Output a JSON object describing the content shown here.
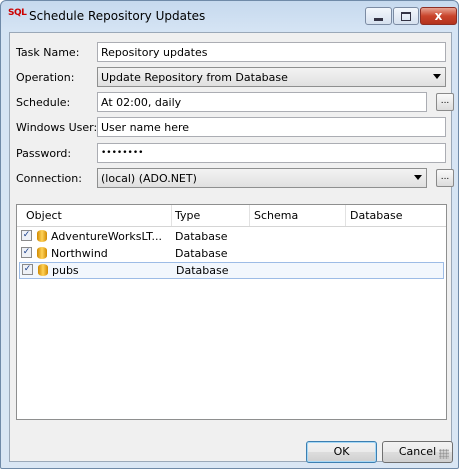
{
  "window": {
    "icon_text": "SQL",
    "title": "Schedule Repository Updates",
    "close_glyph": "x"
  },
  "form": {
    "task_name": {
      "label": "Task Name:",
      "value": "Repository updates"
    },
    "operation": {
      "label": "Operation:",
      "value": "Update Repository from Database"
    },
    "schedule": {
      "label": "Schedule:",
      "value": "At 02:00, daily",
      "button": "..."
    },
    "windows_user": {
      "label": "Windows User:",
      "value": "User name here"
    },
    "password": {
      "label": "Password:",
      "value": "••••••••"
    },
    "connection": {
      "label": "Connection:",
      "value": "(local) (ADO.NET)",
      "button": "..."
    }
  },
  "grid": {
    "columns": [
      "Object",
      "Type",
      "Schema",
      "Database"
    ],
    "rows": [
      {
        "checked": true,
        "object": "AdventureWorksLT...",
        "type": "Database",
        "schema": "",
        "database": ""
      },
      {
        "checked": true,
        "object": "Northwind",
        "type": "Database",
        "schema": "",
        "database": ""
      },
      {
        "checked": true,
        "object": "pubs",
        "type": "Database",
        "schema": "",
        "database": ""
      }
    ],
    "check_glyph": "✓"
  },
  "buttons": {
    "ok": "OK",
    "cancel": "Cancel"
  },
  "colors": {
    "titlebar": "#c6d9ee",
    "close": "#c9442c",
    "selected_row": "#f2f7fd"
  },
  "icons": [
    "sql-app-icon",
    "minimize-icon",
    "maximize-icon",
    "close-icon",
    "database-icon",
    "checkbox-icon",
    "dropdown-arrow-icon",
    "size-grip-icon"
  ]
}
